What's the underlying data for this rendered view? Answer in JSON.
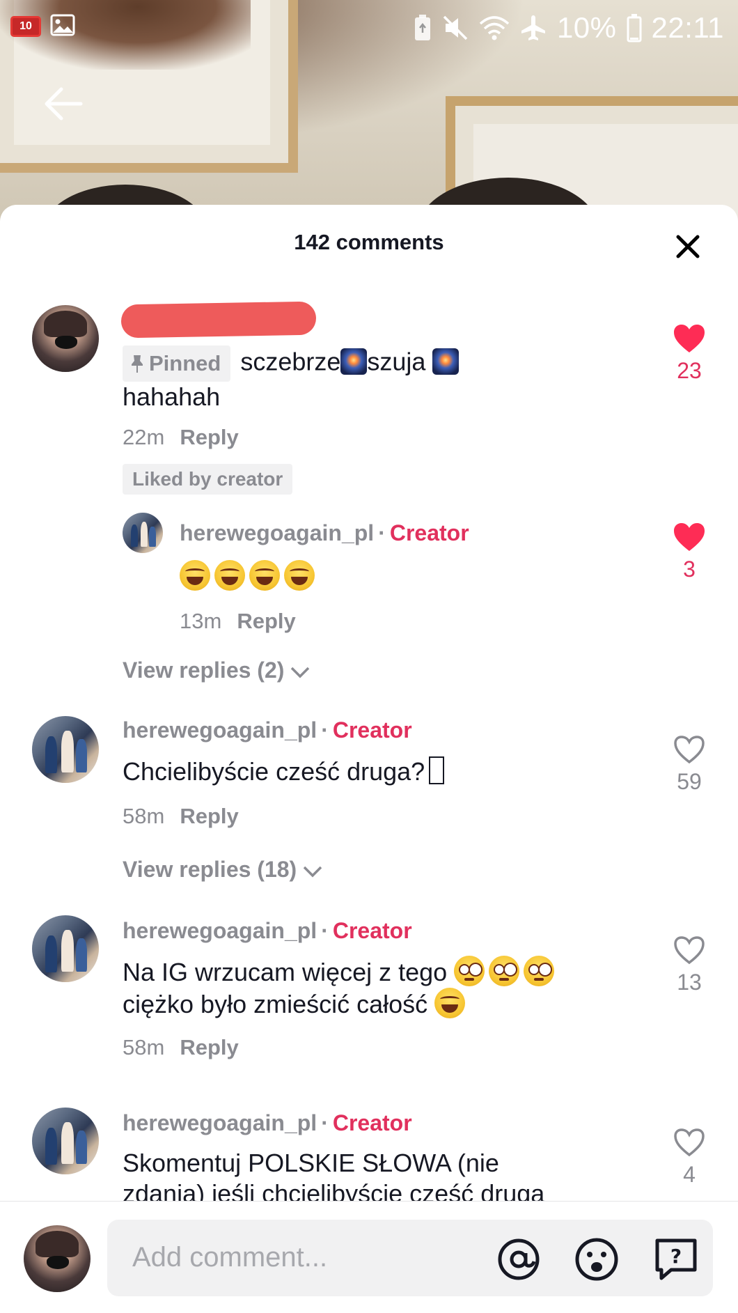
{
  "status_bar": {
    "notification_count": "10",
    "battery_percent": "10%",
    "time": "22:11"
  },
  "sheet": {
    "title": "142 comments"
  },
  "comments": [
    {
      "pinned_label": "Pinned",
      "text_a": "sczebrze",
      "text_b": "szuja",
      "text_c": "hahahah",
      "time": "22m",
      "reply": "Reply",
      "liked_by_creator": "Liked by creator",
      "likes": "23",
      "liked": true,
      "replies": [
        {
          "username": "herewegoagain_pl",
          "separator": "·",
          "badge": "Creator",
          "time": "13m",
          "reply": "Reply",
          "likes": "3",
          "liked": true
        }
      ],
      "view_replies": "View replies (2)"
    },
    {
      "username": "herewegoagain_pl",
      "separator": "·",
      "badge": "Creator",
      "text": "Chcielibyście cześć druga?",
      "time": "58m",
      "reply": "Reply",
      "likes": "59",
      "liked": false,
      "view_replies": "View replies (18)"
    },
    {
      "username": "herewegoagain_pl",
      "separator": "·",
      "badge": "Creator",
      "text_line1": "Na IG wrzucam więcej z tego",
      "text_line2": "ciężko było zmieścić całość",
      "time": "58m",
      "reply": "Reply",
      "likes": "13",
      "liked": false
    },
    {
      "username": "herewegoagain_pl",
      "separator": "·",
      "badge": "Creator",
      "text_line1": "Skomentuj POLSKIE SŁOWA (nie",
      "text_line2": "zdania) jeśli chcielibyście cześć druga",
      "likes": "4",
      "liked": false
    }
  ],
  "input": {
    "placeholder": "Add comment..."
  },
  "colors": {
    "accent": "#e1305d",
    "muted_text": "#8a8b91",
    "text": "#161823"
  },
  "icons": [
    "back-arrow-icon",
    "close-icon",
    "heart-icon",
    "mention-icon",
    "emoji-icon",
    "question-icon"
  ]
}
